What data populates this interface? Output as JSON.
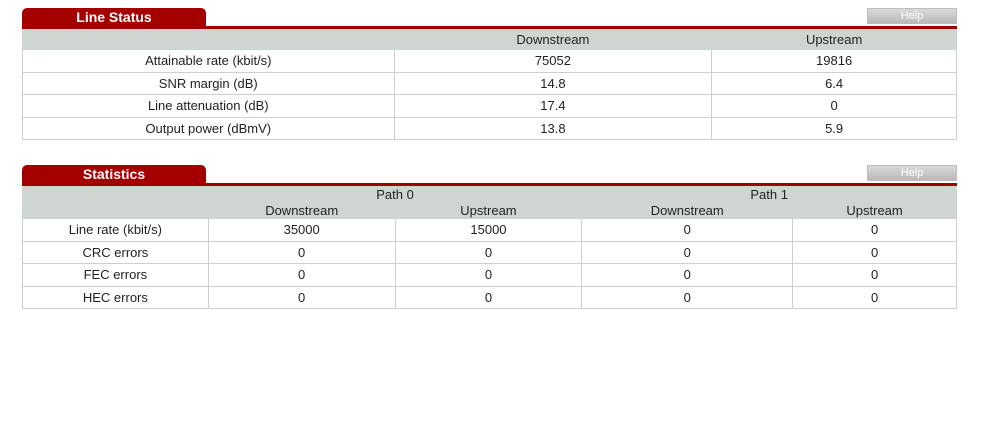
{
  "line_status": {
    "title": "Line Status",
    "help_label": "Help",
    "columns": [
      "",
      "Downstream",
      "Upstream"
    ],
    "rows": [
      {
        "label": "Attainable rate (kbit/s)",
        "down": "75052",
        "up": "19816"
      },
      {
        "label": "SNR margin (dB)",
        "down": "14.8",
        "up": "6.4"
      },
      {
        "label": "Line attenuation (dB)",
        "down": "17.4",
        "up": "0"
      },
      {
        "label": "Output power (dBmV)",
        "down": "13.8",
        "up": "5.9"
      }
    ]
  },
  "statistics": {
    "title": "Statistics",
    "help_label": "Help",
    "path0": "Path 0",
    "path1": "Path 1",
    "sub_columns": [
      "Downstream",
      "Upstream",
      "Downstream",
      "Upstream"
    ],
    "rows": [
      {
        "label": "Line rate (kbit/s)",
        "p0_down": "35000",
        "p0_up": "15000",
        "p1_down": "0",
        "p1_up": "0"
      },
      {
        "label": "CRC errors",
        "p0_down": "0",
        "p0_up": "0",
        "p1_down": "0",
        "p1_up": "0"
      },
      {
        "label": "FEC errors",
        "p0_down": "0",
        "p0_up": "0",
        "p1_down": "0",
        "p1_up": "0"
      },
      {
        "label": "HEC errors",
        "p0_down": "0",
        "p0_up": "0",
        "p1_down": "0",
        "p1_up": "0"
      }
    ]
  }
}
